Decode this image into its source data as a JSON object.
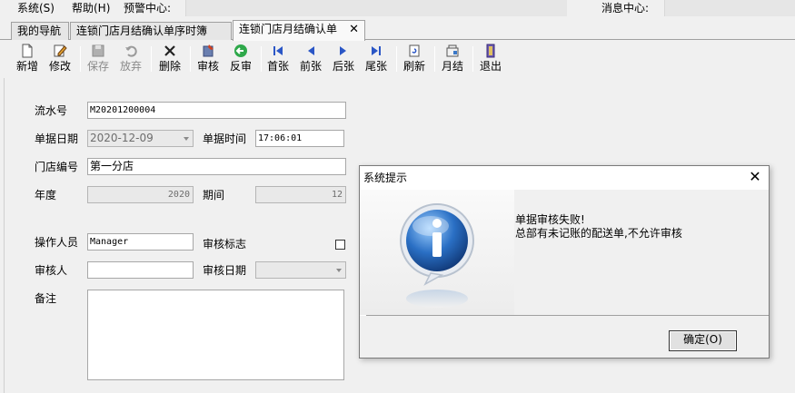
{
  "menubar": {
    "system": "系统(S)",
    "help": "帮助(H)",
    "alert_center": "预警中心:",
    "message_center": "消息中心:"
  },
  "tabs": [
    {
      "label": "我的导航"
    },
    {
      "label": "连锁门店月结确认单序时簿"
    },
    {
      "label": "连锁门店月结确认单",
      "active": true
    }
  ],
  "toolbar": {
    "buttons": [
      {
        "label": "新增",
        "icon": "new-document-icon",
        "enabled": true
      },
      {
        "label": "修改",
        "icon": "edit-icon",
        "enabled": true
      },
      {
        "label": "保存",
        "icon": "save-disk-icon",
        "enabled": false
      },
      {
        "label": "放弃",
        "icon": "undo-icon",
        "enabled": false
      },
      {
        "label": "删除",
        "icon": "delete-x-icon",
        "enabled": true
      },
      {
        "label": "审核",
        "icon": "audit-icon",
        "enabled": true
      },
      {
        "label": "反审",
        "icon": "unaudit-icon",
        "enabled": true
      },
      {
        "label": "首张",
        "icon": "first-record-icon",
        "enabled": true
      },
      {
        "label": "前张",
        "icon": "previous-record-icon",
        "enabled": true
      },
      {
        "label": "后张",
        "icon": "next-record-icon",
        "enabled": true
      },
      {
        "label": "尾张",
        "icon": "last-record-icon",
        "enabled": true
      },
      {
        "label": "刷新",
        "icon": "refresh-icon",
        "enabled": true
      },
      {
        "label": "月结",
        "icon": "month-end-icon",
        "enabled": true
      },
      {
        "label": "退出",
        "icon": "exit-door-icon",
        "enabled": true
      }
    ]
  },
  "form": {
    "serial_label": "流水号",
    "serial_value": "M20201200004",
    "date_label": "单据日期",
    "date_value": "2020-12-09",
    "time_label": "单据时间",
    "time_value": "17:06:01",
    "store_label": "门店编号",
    "store_value": "第一分店",
    "year_label": "年度",
    "year_value": "2020",
    "period_label": "期间",
    "period_value": "12",
    "operator_label": "操作人员",
    "operator_value": "Manager",
    "audit_flag_label": "审核标志",
    "audit_flag_checked": false,
    "auditor_label": "审核人",
    "auditor_value": "",
    "audit_date_label": "审核日期",
    "audit_date_value": "",
    "remark_label": "备注",
    "remark_value": ""
  },
  "dialog": {
    "title": "系统提示",
    "message_line1": "单据审核失败!",
    "message_line2": "总部有未记账的配送单,不允许审核",
    "ok_label": "确定(O)",
    "icon": "info-icon"
  }
}
